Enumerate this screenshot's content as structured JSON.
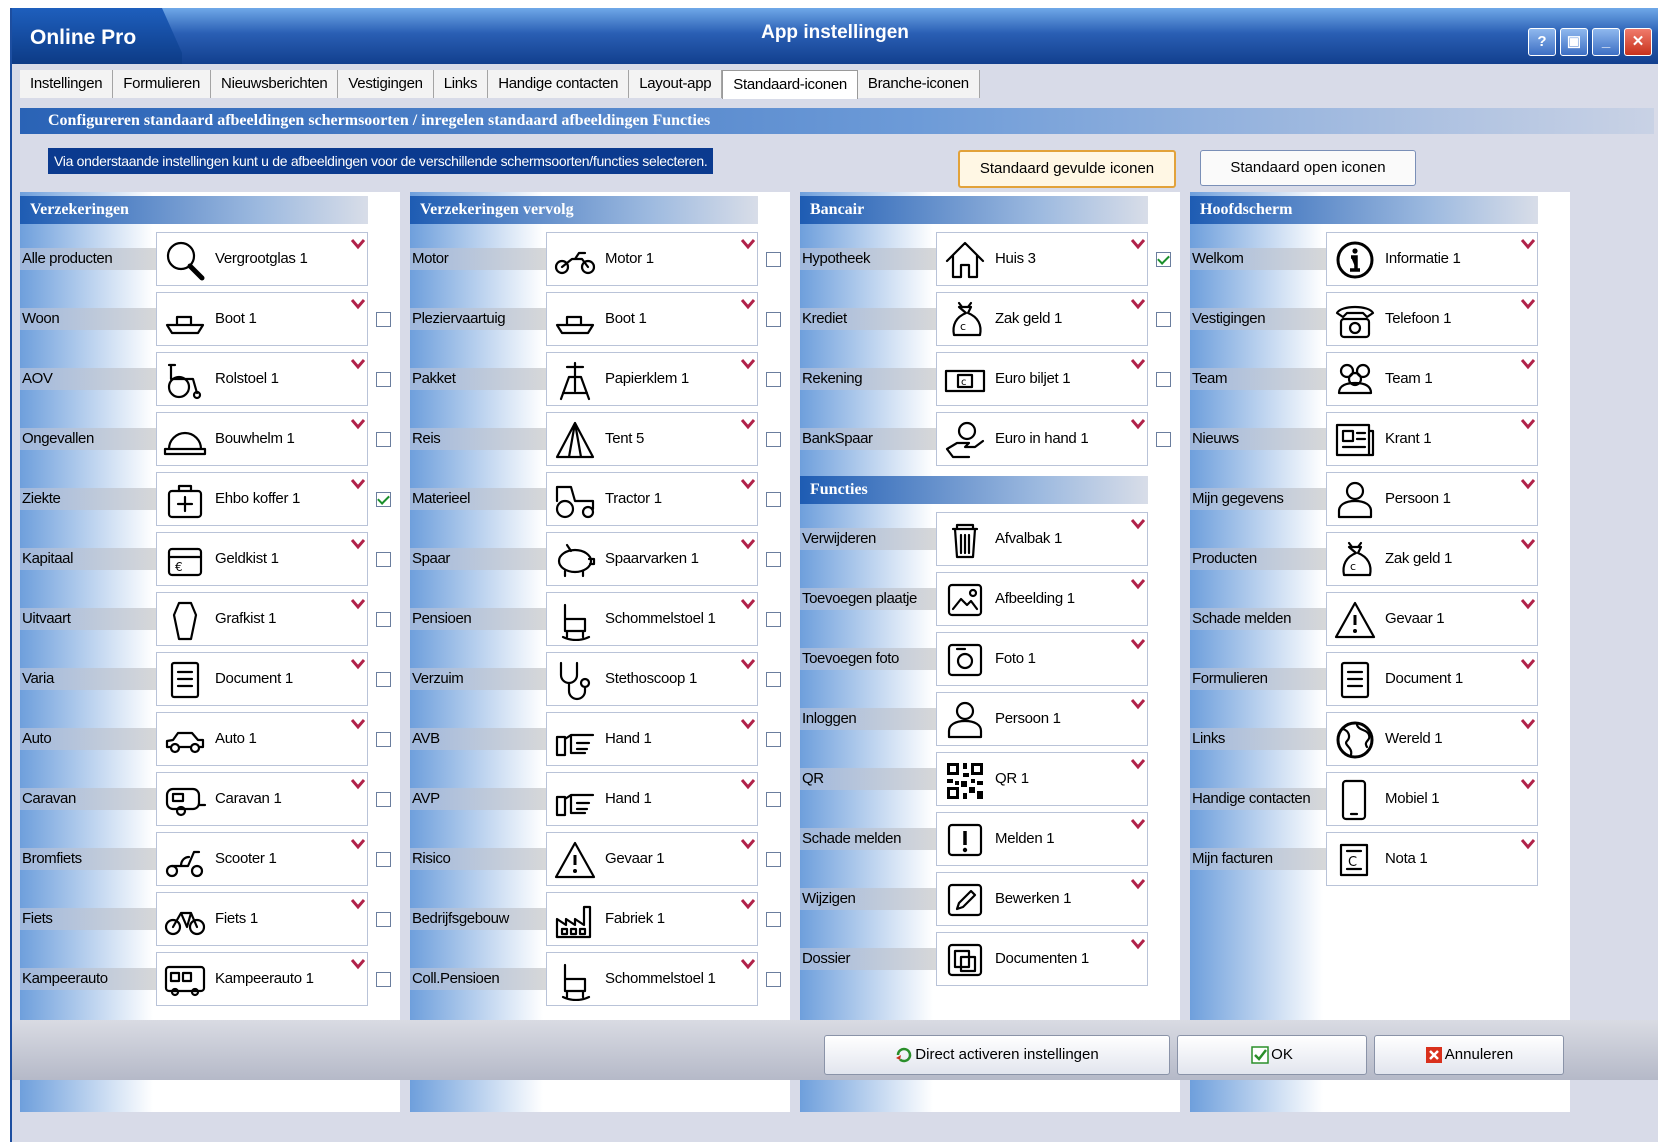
{
  "window": {
    "brand": "Online Pro",
    "title": "App instellingen"
  },
  "tabs": [
    "Instellingen",
    "Formulieren",
    "Nieuwsberichten",
    "Vestigingen",
    "Links",
    "Handige contacten",
    "Layout-app",
    "Standaard-iconen",
    "Branche-iconen"
  ],
  "active_tab": "Standaard-iconen",
  "header": {
    "title": "Configureren standaard afbeeldingen schermsoorten / inregelen standaard afbeeldingen Functies",
    "info": "Via onderstaande instellingen kunt u de afbeeldingen voor de verschillende schermsoorten/functies selecteren."
  },
  "buttons": {
    "filled": "Standaard gevulde iconen",
    "open": "Standaard open iconen"
  },
  "columns": [
    {
      "title": "Verzekeringen",
      "rows": [
        {
          "label": "Alle producten",
          "icon": "Vergrootglas 1",
          "sym": "magnifier-icon",
          "checkbox": null
        },
        {
          "label": "Woon",
          "icon": "Boot 1",
          "sym": "boat-icon",
          "checkbox": false
        },
        {
          "label": "AOV",
          "icon": "Rolstoel 1",
          "sym": "wheelchair-icon",
          "checkbox": false
        },
        {
          "label": "Ongevallen",
          "icon": "Bouwhelm 1",
          "sym": "helmet-icon",
          "checkbox": false
        },
        {
          "label": "Ziekte",
          "icon": "Ehbo koffer 1",
          "sym": "firstaid-icon",
          "checkbox": true
        },
        {
          "label": "Kapitaal",
          "icon": "Geldkist 1",
          "sym": "moneybox-icon",
          "checkbox": false
        },
        {
          "label": "Uitvaart",
          "icon": "Grafkist 1",
          "sym": "coffin-icon",
          "checkbox": false
        },
        {
          "label": "Varia",
          "icon": "Document 1",
          "sym": "document-icon",
          "checkbox": false
        },
        {
          "label": "Auto",
          "icon": "Auto 1",
          "sym": "car-icon",
          "checkbox": false
        },
        {
          "label": "Caravan",
          "icon": "Caravan 1",
          "sym": "caravan-icon",
          "checkbox": false
        },
        {
          "label": "Bromfiets",
          "icon": "Scooter 1",
          "sym": "scooter-icon",
          "checkbox": false
        },
        {
          "label": "Fiets",
          "icon": "Fiets 1",
          "sym": "bicycle-icon",
          "checkbox": false
        },
        {
          "label": "Kampeerauto",
          "icon": "Kampeerauto 1",
          "sym": "camper-icon",
          "checkbox": false
        }
      ]
    },
    {
      "title": "Verzekeringen vervolg",
      "rows": [
        {
          "label": "Motor",
          "icon": "Motor 1",
          "sym": "motorcycle-icon",
          "checkbox": false
        },
        {
          "label": "Pleziervaartuig",
          "icon": "Boot 1",
          "sym": "boat-icon",
          "checkbox": false
        },
        {
          "label": "Pakket",
          "icon": "Papierklem 1",
          "sym": "paperclip-icon",
          "checkbox": false
        },
        {
          "label": "Reis",
          "icon": "Tent 5",
          "sym": "tent-icon",
          "checkbox": false
        },
        {
          "label": "Materieel",
          "icon": "Tractor 1",
          "sym": "tractor-icon",
          "checkbox": false
        },
        {
          "label": "Spaar",
          "icon": "Spaarvarken 1",
          "sym": "piggybank-icon",
          "checkbox": false
        },
        {
          "label": "Pensioen",
          "icon": "Schommelstoel 1",
          "sym": "rockingchair-icon",
          "checkbox": false
        },
        {
          "label": "Verzuim",
          "icon": "Stethoscoop 1",
          "sym": "stethoscope-icon",
          "checkbox": false
        },
        {
          "label": "AVB",
          "icon": "Hand 1",
          "sym": "hand-icon",
          "checkbox": false
        },
        {
          "label": "AVP",
          "icon": "Hand 1",
          "sym": "hand-icon",
          "checkbox": false
        },
        {
          "label": "Risico",
          "icon": "Gevaar 1",
          "sym": "warning-icon",
          "checkbox": false
        },
        {
          "label": "Bedrijfsgebouw",
          "icon": "Fabriek 1",
          "sym": "factory-icon",
          "checkbox": false
        },
        {
          "label": "Coll.Pensioen",
          "icon": "Schommelstoel 1",
          "sym": "rockingchair-icon",
          "checkbox": false
        }
      ]
    },
    {
      "title": "Bancair",
      "rows": [
        {
          "label": "Hypotheek",
          "icon": "Huis 3",
          "sym": "house-icon",
          "checkbox": true
        },
        {
          "label": "Krediet",
          "icon": "Zak geld 1",
          "sym": "moneybag-icon",
          "checkbox": false
        },
        {
          "label": "Rekening",
          "icon": "Euro biljet 1",
          "sym": "banknote-icon",
          "checkbox": false
        },
        {
          "label": "BankSpaar",
          "icon": "Euro in hand 1",
          "sym": "coinhand-icon",
          "checkbox": false
        }
      ],
      "subtitle": "Functies",
      "subrows": [
        {
          "label": "Verwijderen",
          "icon": "Afvalbak 1",
          "sym": "trash-icon"
        },
        {
          "label": "Toevoegen plaatje",
          "icon": "Afbeelding 1",
          "sym": "image-icon"
        },
        {
          "label": "Toevoegen foto",
          "icon": "Foto 1",
          "sym": "camera-icon"
        },
        {
          "label": "Inloggen",
          "icon": "Persoon 1",
          "sym": "person-icon"
        },
        {
          "label": "QR",
          "icon": "QR 1",
          "sym": "qr-icon"
        },
        {
          "label": "Schade melden",
          "icon": "Melden 1",
          "sym": "alert-icon"
        },
        {
          "label": "Wijzigen",
          "icon": "Bewerken 1",
          "sym": "edit-icon"
        },
        {
          "label": "Dossier",
          "icon": "Documenten 1",
          "sym": "documents-icon"
        }
      ]
    },
    {
      "title": "Hoofdscherm",
      "rows": [
        {
          "label": "Welkom",
          "icon": "Informatie 1",
          "sym": "info-icon",
          "checkbox": null
        },
        {
          "label": "Vestigingen",
          "icon": "Telefoon 1",
          "sym": "phone-icon",
          "checkbox": null
        },
        {
          "label": "Team",
          "icon": "Team 1",
          "sym": "team-icon",
          "checkbox": null
        },
        {
          "label": "Nieuws",
          "icon": "Krant 1",
          "sym": "newspaper-icon",
          "checkbox": null
        },
        {
          "label": "Mijn gegevens",
          "icon": "Persoon 1",
          "sym": "person-icon",
          "checkbox": null
        },
        {
          "label": "Producten",
          "icon": "Zak geld 1",
          "sym": "moneybag-icon",
          "checkbox": null
        },
        {
          "label": "Schade melden",
          "icon": "Gevaar 1",
          "sym": "warning-icon",
          "checkbox": null
        },
        {
          "label": "Formulieren",
          "icon": "Document 1",
          "sym": "document-icon",
          "checkbox": null
        },
        {
          "label": "Links",
          "icon": "Wereld 1",
          "sym": "globe-icon",
          "checkbox": null
        },
        {
          "label": "Handige contacten",
          "icon": "Mobiel 1",
          "sym": "mobile-icon",
          "checkbox": null
        },
        {
          "label": "Mijn facturen",
          "icon": "Nota 1",
          "sym": "invoice-icon",
          "checkbox": null
        }
      ]
    }
  ],
  "footer": {
    "activate": "Direct activeren instellingen",
    "ok": "OK",
    "cancel": "Annuleren"
  },
  "colors": {
    "title_bar": "#2a5fb4",
    "accent": "#0b3a8f",
    "dropdown_arrow": "#b0224a",
    "check": "#1a8f2a"
  }
}
